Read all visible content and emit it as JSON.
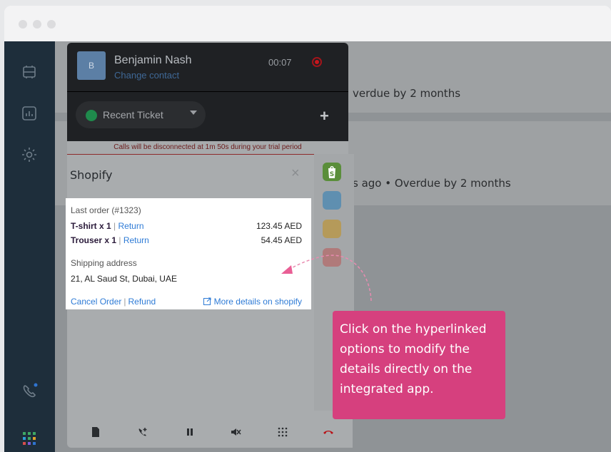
{
  "window": {
    "title": ""
  },
  "background": {
    "row1_text": "verdue by 2 months",
    "row2_text": "s ago • Overdue by 2 months"
  },
  "dialer": {
    "avatar_initial": "B",
    "contact_name": "Benjamin Nash",
    "change_contact": "Change contact",
    "timer": "00:07",
    "ticket_label": "Recent Ticket",
    "plus": "+",
    "trial_notice": "Calls will be disconnected at 1m 50s during your trial period"
  },
  "shopify": {
    "title": "Shopify",
    "close": "×",
    "last_order_label": "Last order (#1323)",
    "items": [
      {
        "name": "T-shirt x 1",
        "action": "Return",
        "price": "123.45 AED"
      },
      {
        "name": "Trouser x 1",
        "action": "Return",
        "price": "54.45 AED"
      }
    ],
    "shipping_label": "Shipping address",
    "shipping_address": "21, AL Saud St, Dubai, UAE",
    "cancel_order": "Cancel Order",
    "separator": "|",
    "refund": "Refund",
    "more_details": "More details on shopify"
  },
  "callout": {
    "text": "Click on the hyperlinked options to modify the details directly on the integrated app."
  },
  "colors": {
    "sidebar": "#1e2e3b",
    "callout": "#d6407e",
    "link": "#2e7bd6",
    "shopify_green": "#5a8e3a"
  }
}
